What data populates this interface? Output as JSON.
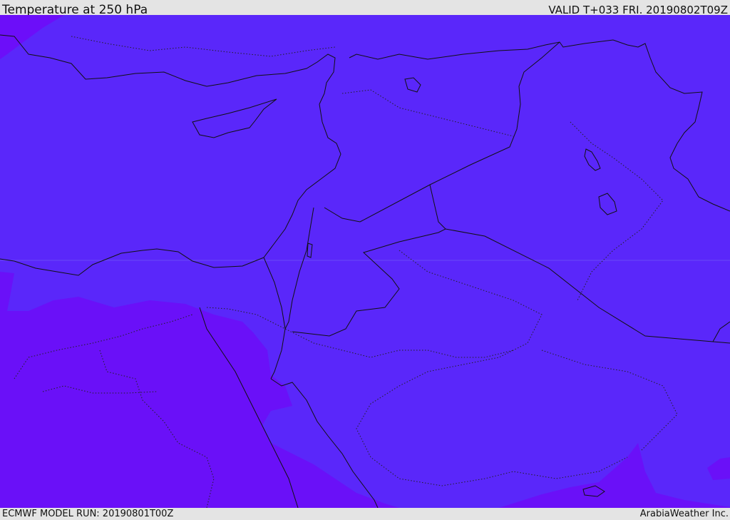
{
  "header": {
    "title": "Temperature at 250 hPa",
    "valid": "VALID T+033 FRI. 20190802T09Z"
  },
  "footer": {
    "model_run": "ECMWF MODEL RUN: 20190801T00Z",
    "brand": "ArabiaWeather Inc."
  },
  "map": {
    "colors": {
      "field_main": "#5a27fa",
      "field_warm": "#6a10f8",
      "field_edge": "#6c0ef9",
      "border": "#111111"
    }
  }
}
